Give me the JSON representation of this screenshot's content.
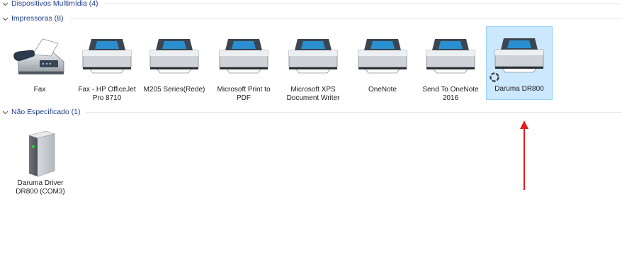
{
  "groups": {
    "multimedia": {
      "label": "Dispositivos Multimídia (4)"
    },
    "printers": {
      "label": "Impressoras (8)",
      "items": [
        {
          "name": "Fax",
          "icon": "fax-icon"
        },
        {
          "name": "Fax - HP OfficeJet Pro 8710",
          "icon": "printer-icon"
        },
        {
          "name": "M205 Series(Rede)",
          "icon": "printer-icon"
        },
        {
          "name": "Microsoft Print to PDF",
          "icon": "printer-icon"
        },
        {
          "name": "Microsoft XPS Document Writer",
          "icon": "printer-icon"
        },
        {
          "name": "OneNote",
          "icon": "printer-icon"
        },
        {
          "name": "Send To OneNote 2016",
          "icon": "printer-icon"
        },
        {
          "name": "Daruma DR800",
          "icon": "printer-icon",
          "selected": true
        }
      ]
    },
    "unspecified": {
      "label": "Não Especificado (1)",
      "items": [
        {
          "name": "Daruma Driver DR800 (COM3)",
          "icon": "computer-tower-icon"
        }
      ]
    }
  },
  "annotation": {
    "icon": "red-arrow-icon",
    "color": "#e02020"
  },
  "colors": {
    "header_text": "#1e3c8c",
    "selection_bg": "#cce8ff",
    "selection_border": "#99d1ff"
  }
}
